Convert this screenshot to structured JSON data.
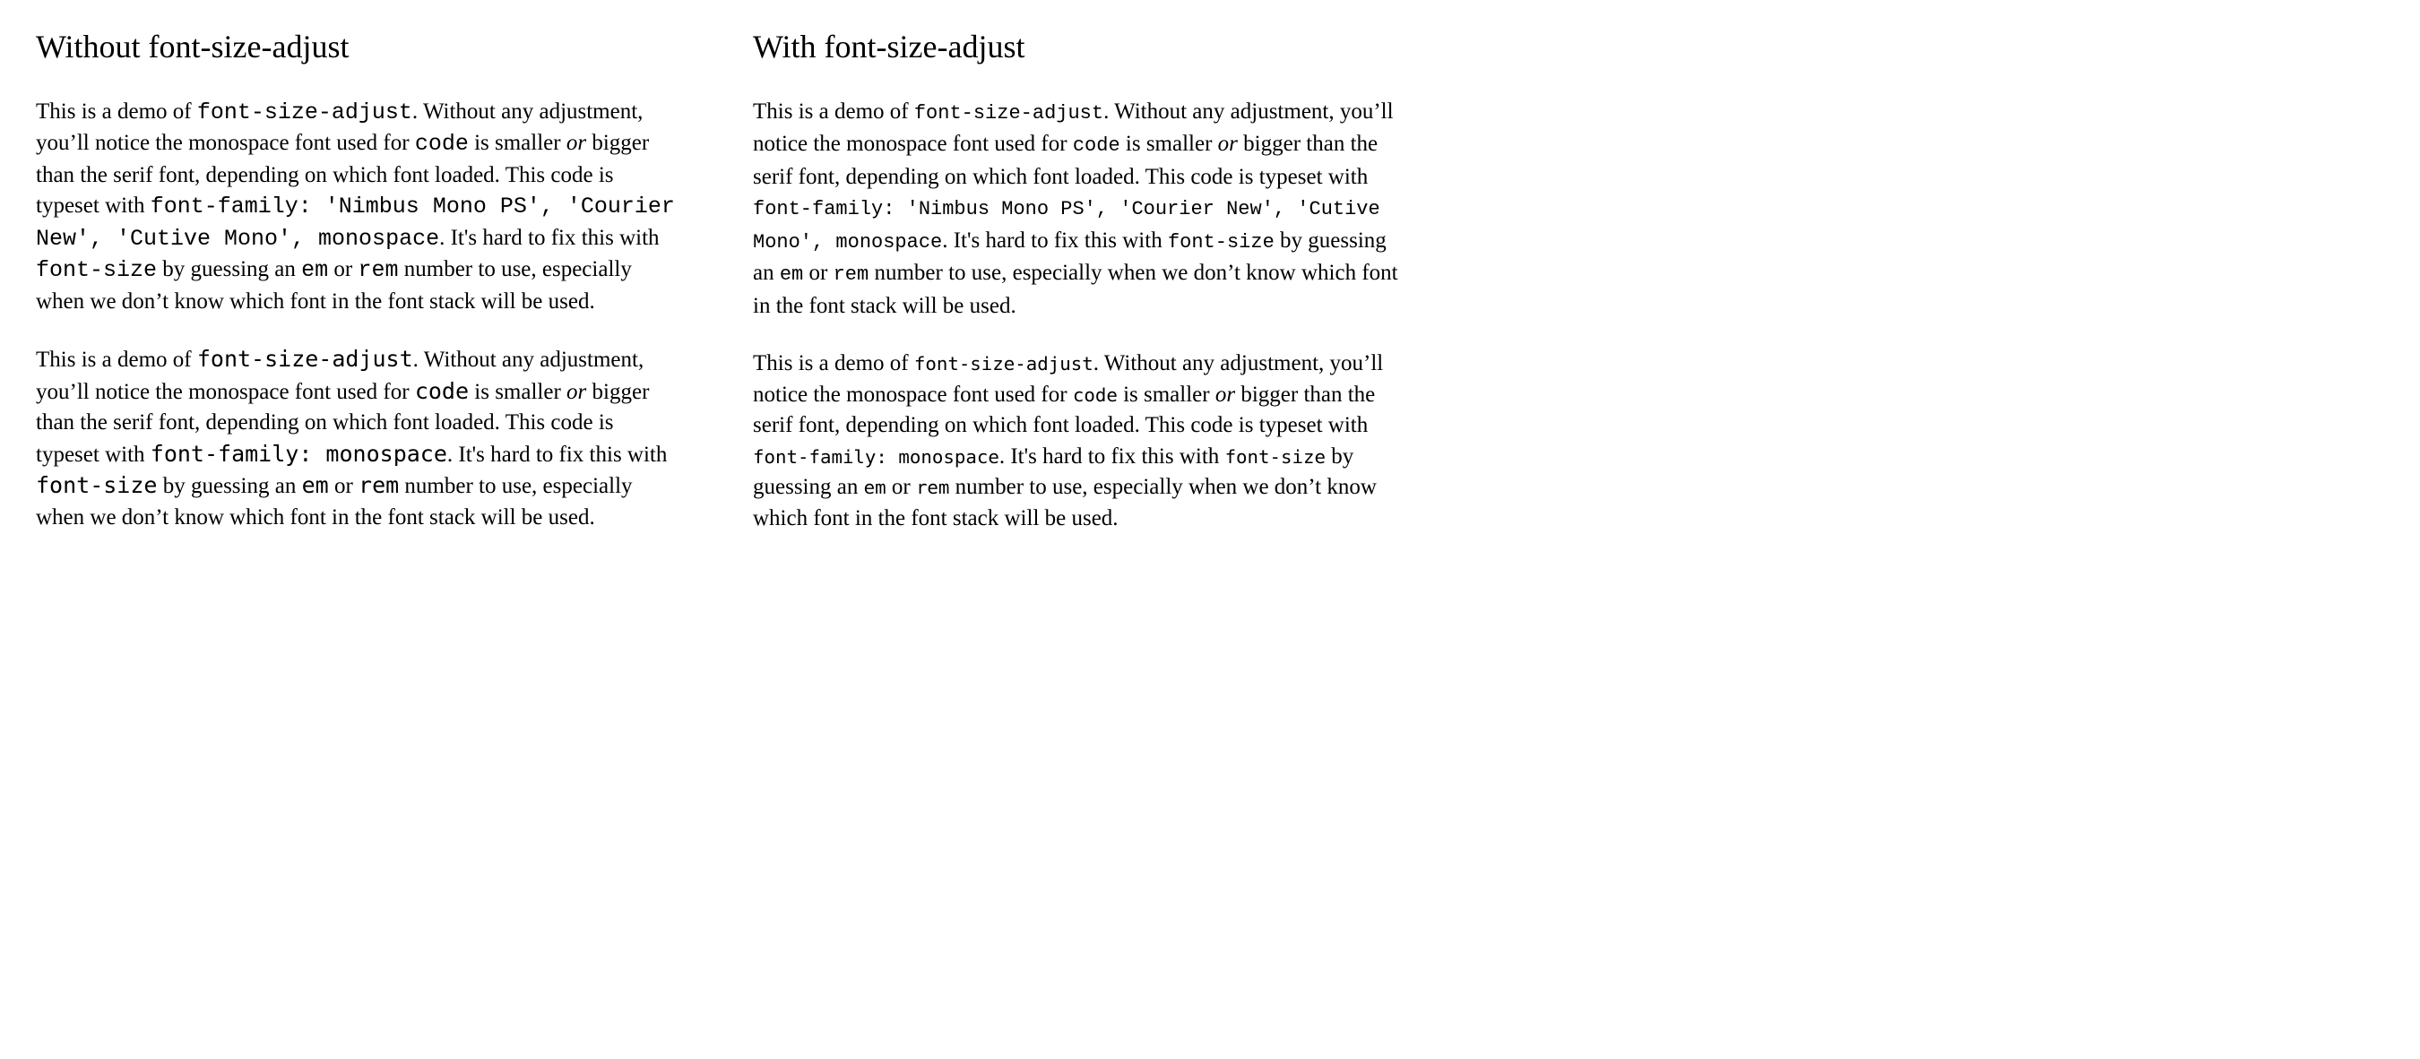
{
  "headings": {
    "left": "Without font-size-adjust",
    "right": "With font-size-adjust"
  },
  "text": {
    "s1": "This is a demo of ",
    "c1": "font-size-adjust",
    "s2": ". Without any adjustment, you’ll notice the monospace font used for ",
    "c2": "code",
    "s3": " is smaller ",
    "em1": "or",
    "s4": " bigger than the serif font, depending on which font loaded. This code is typeset with ",
    "c3a": "font-family: 'Nimbus Mono PS', 'Courier New', 'Cutive Mono', monospace",
    "c3b": "font-family: monospace",
    "s5": ". It's hard to fix this with ",
    "c4": "font-size",
    "s6": " by guessing an ",
    "c5": "em",
    "s7": " or ",
    "c6": "rem",
    "s8": " number to use, especially when we don’t know which font in the font stack will be used."
  }
}
